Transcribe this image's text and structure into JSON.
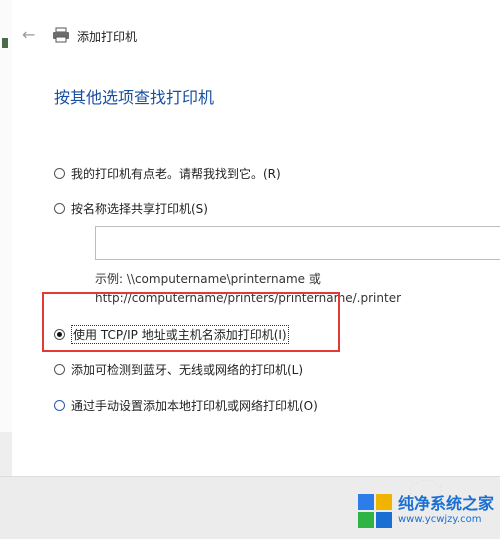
{
  "window": {
    "title": "添加打印机"
  },
  "page": {
    "title": "按其他选项查找打印机"
  },
  "options": [
    {
      "label": "我的打印机有点老。请帮我找到它。(R)",
      "checked": false
    },
    {
      "label": "按名称选择共享打印机(S)",
      "checked": false
    },
    {
      "label": "使用 TCP/IP 地址或主机名添加打印机(I)",
      "checked": true
    },
    {
      "label": "添加可检测到蓝牙、无线或网络的打印机(L)",
      "checked": false
    },
    {
      "label": "通过手动设置添加本地打印机或网络打印机(O)",
      "checked": false
    }
  ],
  "shared_printer": {
    "input_value": "",
    "example_line1": "示例: \\\\computername\\printername 或",
    "example_line2": "http://computername/printers/printername/.printer"
  },
  "watermark": {
    "title": "纯净系统之家",
    "url": "www.ycwjzy.com"
  },
  "colors": {
    "title_blue": "#1a4fa0",
    "highlight_red": "#e23a34",
    "watermark_blue": "#1a6fd3"
  },
  "icons": {
    "back": "back-arrow-icon",
    "printer": "printer-icon"
  }
}
